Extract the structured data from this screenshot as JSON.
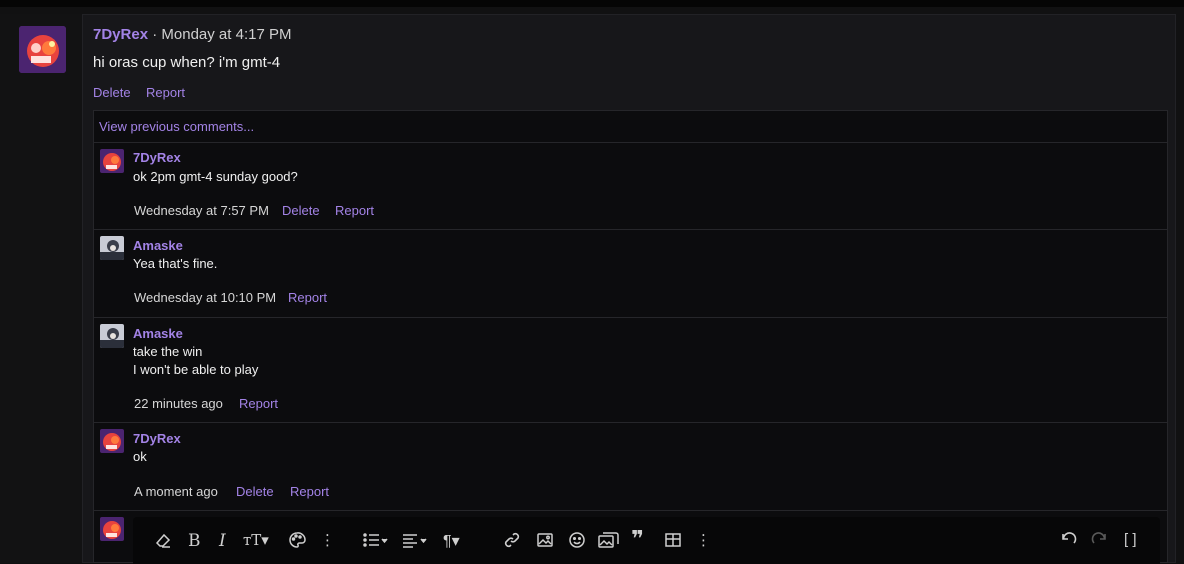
{
  "post": {
    "author": "7DyRex",
    "time": "Monday at 4:17 PM",
    "separator": "·",
    "body": "hi oras cup when? i'm gmt-4",
    "actions": {
      "delete": "Delete",
      "report": "Report"
    }
  },
  "thread": {
    "view_previous": "View previous comments...",
    "comments": [
      {
        "author": "7DyRex",
        "lines": [
          "ok 2pm gmt-4 sunday good?"
        ],
        "time": "Wednesday at 7:57 PM",
        "delete": "Delete",
        "report": "Report"
      },
      {
        "author": "Amaske",
        "lines": [
          "Yea that's fine."
        ],
        "time": "Wednesday at 10:10 PM",
        "report": "Report"
      },
      {
        "author": "Amaske",
        "lines": [
          "take the win",
          "I won't be able to play"
        ],
        "time": "22 minutes ago",
        "report": "Report"
      },
      {
        "author": "7DyRex",
        "lines": [
          "ok"
        ],
        "time": "A moment ago",
        "delete": "Delete",
        "report": "Report"
      }
    ]
  },
  "editor": {
    "toolbar": [
      "eraser-icon",
      "bold-icon",
      "italic-icon",
      "text-size-icon",
      "palette-icon",
      "more-icon",
      "list-icon",
      "align-icon",
      "paragraph-icon",
      "link-icon",
      "image-icon",
      "emoji-icon",
      "media-icon",
      "quote-icon",
      "table-icon",
      "more-icon",
      "undo-icon",
      "redo-icon",
      "fullscreen-icon"
    ]
  },
  "colors": {
    "accent": "#a383e6",
    "background": "#17171a",
    "thread_bg": "#0c0c0e"
  }
}
